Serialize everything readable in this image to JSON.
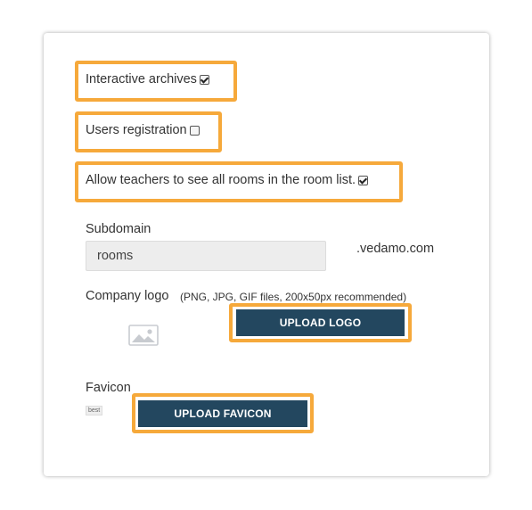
{
  "options": {
    "interactive_archives": {
      "label": "Interactive archives",
      "checked": true
    },
    "users_registration": {
      "label": "Users registration",
      "checked": false
    },
    "allow_teachers": {
      "label": "Allow teachers to see all rooms in the room list.",
      "checked": true
    }
  },
  "subdomain": {
    "label": "Subdomain",
    "value": "rooms",
    "suffix": ".vedamo.com"
  },
  "company_logo": {
    "label": "Company logo",
    "hint": "(PNG, JPG, GIF files, 200x50px recommended)",
    "placeholder_icon": "image-icon",
    "upload_label": "UPLOAD LOGO"
  },
  "favicon": {
    "label": "Favicon",
    "preview_text": "best",
    "upload_label": "UPLOAD FAVICON"
  },
  "colors": {
    "highlight": "#f6a93b",
    "button_bg": "#23475f",
    "input_bg": "#ededed"
  }
}
